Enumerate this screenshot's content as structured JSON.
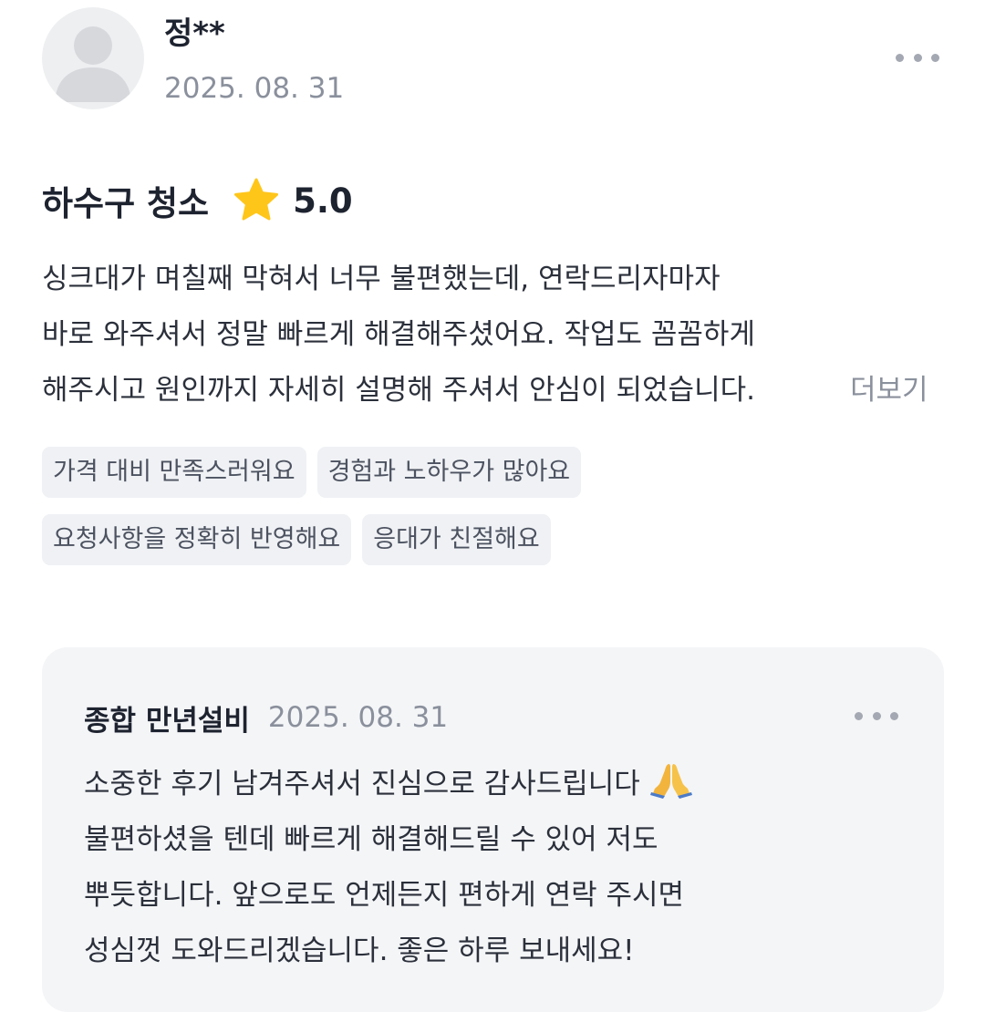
{
  "review": {
    "author": "정**",
    "date": "2025. 08. 31",
    "service": "하수구 청소",
    "rating": "5.0",
    "body_lines": [
      "싱크대가 며칠째 막혀서 너무 불편했는데, 연락드리자마자",
      "바로 와주셔서 정말 빠르게 해결해주셨어요. 작업도 꼼꼼하게",
      "해주시고 원인까지 자세히 설명해 주셔서 안심이 되었습니다."
    ],
    "see_more_label": "더보기",
    "tags": [
      [
        "가격 대비 만족스러워요",
        "경험과 노하우가 많아요"
      ],
      [
        "요청사항을 정확히 반영해요",
        "응대가 친절해요"
      ]
    ]
  },
  "reply": {
    "author": "종합 만년설비",
    "date": "2025. 08. 31",
    "body_lines": [
      "소중한 후기 남겨주셔서 진심으로 감사드립니다",
      "불편하셨을 텐데 빠르게 해결해드릴 수 있어 저도",
      "뿌듯합니다. 앞으로도 언제든지 편하게 연락 주시면",
      "성심껏 도와드리겠습니다. 좋은 하루 보내세요!"
    ]
  },
  "icons": {
    "avatar": "person-silhouette-icon",
    "rating": "star-icon",
    "menu": "more-dots-icon",
    "reply_emoji": "folded-hands-icon"
  },
  "colors": {
    "star": "#FFC61A",
    "muted_text": "#8A909C",
    "tag_background": "#EFF1F4",
    "reply_background": "#F4F5F7"
  }
}
